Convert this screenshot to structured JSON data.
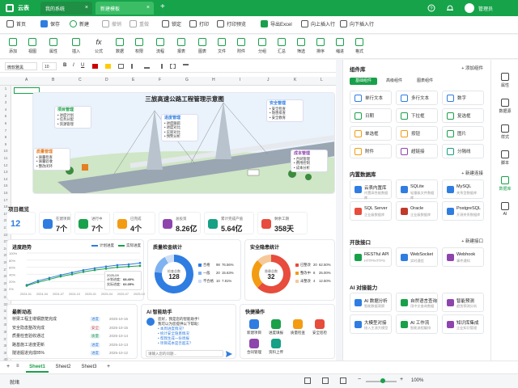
{
  "topbar": {
    "app_name": "云表",
    "tabs": [
      {
        "label": "我的系统"
      },
      {
        "label": "新建模板"
      }
    ],
    "add_tab": "+",
    "user": "管理员"
  },
  "toolbar1": [
    {
      "label": "首页"
    },
    {
      "label": "保存"
    },
    {
      "label": "新建"
    },
    {
      "label": "撤销"
    },
    {
      "label": "重做"
    },
    {
      "label": "锁定"
    },
    {
      "label": "打印"
    },
    {
      "label": "打印预览"
    },
    {
      "label": "导出Excel"
    },
    {
      "label": "向上插入行"
    },
    {
      "label": "向下插入行"
    }
  ],
  "toolbar2": [
    {
      "label": "添加"
    },
    {
      "label": "视图"
    },
    {
      "label": "属性"
    },
    {
      "label": "插入"
    },
    {
      "label": "公式"
    },
    {
      "label": "数据"
    },
    {
      "label": "权限"
    },
    {
      "label": "流程"
    },
    {
      "label": "报表"
    },
    {
      "label": "图表"
    },
    {
      "label": "文件"
    },
    {
      "label": "附件"
    },
    {
      "label": "分组"
    },
    {
      "label": "汇总"
    },
    {
      "label": "筛选"
    },
    {
      "label": "排序"
    },
    {
      "label": "缩进"
    },
    {
      "label": "格式"
    }
  ],
  "format_bar": {
    "font": "微软雅黑",
    "size": "10",
    "bold": "B",
    "italic": "I",
    "underline": "U"
  },
  "columns": [
    "A",
    "B",
    "C",
    "D",
    "E",
    "F",
    "G",
    "H",
    "I",
    "J",
    "K",
    "L"
  ],
  "rows": [
    "1",
    "2",
    "3",
    "4",
    "5",
    "6",
    "7",
    "8",
    "9",
    "10",
    "11",
    "12",
    "13",
    "14",
    "15",
    "16",
    "17",
    "18",
    "19",
    "20",
    "21",
    "22",
    "23",
    "24",
    "25",
    "26",
    "27",
    "28",
    "29",
    "30",
    "31",
    "32",
    "33",
    "34",
    "35",
    "36",
    "37",
    "38",
    "39",
    "40"
  ],
  "illustration": {
    "title": "三旅高速公路工程管理示意图",
    "callouts": [
      {
        "title": "项目管理",
        "items": [
          "• 进度计划",
          "• 任务分配",
          "• 资源管理"
        ]
      },
      {
        "title": "进度管理",
        "items": [
          "• 进度跟踪",
          "• 进度对比",
          "• 实际对比",
          "• 预警分析"
        ]
      },
      {
        "title": "安全管理",
        "items": [
          "• 安全检查",
          "• 隐患排查",
          "• 安全教育"
        ]
      },
      {
        "title": "质量管理",
        "items": [
          "• 质量检查",
          "• 质量验收",
          "• 整改闭环"
        ]
      },
      {
        "title": "成本管理",
        "items": [
          "• 合同管理",
          "• 费用控制",
          "• 成本分析"
        ]
      }
    ]
  },
  "overview": {
    "title": "项目概览",
    "kpis": [
      {
        "label": "",
        "value": "12"
      },
      {
        "label": "在建项目",
        "value": "7个"
      },
      {
        "label": "进行中",
        "value": "7个"
      },
      {
        "label": "已完成",
        "value": "4个"
      },
      {
        "label": "总投资",
        "value": "8.26亿"
      },
      {
        "label": "累计完成产值",
        "value": "5.64亿"
      },
      {
        "label": "剩余工期",
        "value": "358天"
      }
    ]
  },
  "progress_chart": {
    "title": "进度趋势",
    "legend": [
      "计划进度",
      "实际进度"
    ],
    "tooltip": {
      "date": "2025-09",
      "plan_label": "计划进度：",
      "plan_value": "68.40%",
      "actual_label": "实际进度：",
      "actual_value": "62.35%"
    }
  },
  "chart_data": [
    {
      "type": "line",
      "title": "进度趋势",
      "x": [
        "2024-01",
        "2024-04",
        "2024-07",
        "2024-10",
        "2025-01",
        "2025-04",
        "2025-07",
        "2025-10"
      ],
      "series": [
        {
          "name": "计划进度",
          "values": [
            10,
            22,
            30,
            38,
            45,
            52,
            57,
            62,
            66,
            68,
            72
          ]
        },
        {
          "name": "实际进度",
          "values": [
            8,
            18,
            26,
            34,
            40,
            47,
            52,
            56,
            60,
            62,
            64
          ]
        }
      ],
      "ylim": [
        0,
        100
      ],
      "yticks": [
        "100%",
        "80%",
        "60%",
        "40%",
        "20%",
        "0%"
      ]
    },
    {
      "type": "pie",
      "title": "质量检查统计",
      "center_label": "检查总数",
      "center_value": "128",
      "slices": [
        {
          "label": "合格",
          "value": 98,
          "pct": "76.56%"
        },
        {
          "label": "一般",
          "value": 20,
          "pct": "15.63%"
        },
        {
          "label": "不合格",
          "value": 10,
          "pct": "7.81%"
        }
      ]
    },
    {
      "type": "pie",
      "title": "安全隐患统计",
      "center_label": "隐患总数",
      "center_value": "32",
      "slices": [
        {
          "label": "已整改",
          "value": 20,
          "pct": "62.50%"
        },
        {
          "label": "整改中",
          "value": 8,
          "pct": "25.00%"
        },
        {
          "label": "未整改",
          "value": 4,
          "pct": "12.50%"
        }
      ]
    }
  ],
  "news": {
    "title": "最新动态",
    "items": [
      {
        "text": "桥梁工程主墩钢筋笼完成",
        "tag": "进度",
        "date": "2025-10-16"
      },
      {
        "text": "安全隐患整改完成",
        "tag": "安全",
        "date": "2025-10-15"
      },
      {
        "text": "质量检查验收通过",
        "tag": "质量",
        "date": "2025-10-14"
      },
      {
        "text": "路基施工进度更新",
        "tag": "进度",
        "date": "2025-10-13"
      },
      {
        "text": "隧道掘进完成85%",
        "tag": "进度",
        "date": "2025-10-12"
      }
    ]
  },
  "ai_assistant": {
    "title": "AI 智能助手",
    "greeting": "您好，我是您的智能助手！",
    "intro": "我可以为您提供以下帮助：",
    "items": [
      "• 本周进度情况？",
      "• 统计安全隐患情况",
      "• 帮我生成一份周报",
      "• 项目成本是否超支？"
    ],
    "placeholder": "请输入您的问题..."
  },
  "quick_actions": {
    "title": "快捷操作",
    "items": [
      {
        "label": "新建项目",
        "color": "#2f7de1"
      },
      {
        "label": "进度填报",
        "color": "#19a04a"
      },
      {
        "label": "质量检查",
        "color": "#f39c12"
      },
      {
        "label": "安全巡检",
        "color": "#e74c3c"
      },
      {
        "label": "合同管理",
        "color": "#8e44ad"
      },
      {
        "label": "资料上传",
        "color": "#16a085"
      }
    ]
  },
  "sheet_tabs": [
    "Sheet1",
    "Sheet2",
    "Sheet3"
  ],
  "status": {
    "text": "就绪",
    "zoom": "100%"
  },
  "right_panel": {
    "components": {
      "title": "组件库",
      "add": "+ 添加组件",
      "tabs": [
        "基础组件",
        "高级组件",
        "图表组件"
      ],
      "items": [
        {
          "label": "单行文本"
        },
        {
          "label": "多行文本"
        },
        {
          "label": "数字"
        },
        {
          "label": "日期"
        },
        {
          "label": "下拉框"
        },
        {
          "label": "复选框"
        },
        {
          "label": "单选框"
        },
        {
          "label": "按钮"
        },
        {
          "label": "图片"
        },
        {
          "label": "附件"
        },
        {
          "label": "超链接"
        },
        {
          "label": "分隔线"
        }
      ]
    },
    "databases": {
      "title": "内置数据库",
      "add": "+ 新建连接",
      "items": [
        {
          "name": "云表内置库",
          "desc": "内置高性能数据库"
        },
        {
          "name": "SQLite",
          "desc": "轻量级文件数据库"
        },
        {
          "name": "MySQL",
          "desc": "关系型数据库"
        },
        {
          "name": "SQL Server",
          "desc": "企业级数据库"
        },
        {
          "name": "Oracle",
          "desc": "企业级数据库"
        },
        {
          "name": "PostgreSQL",
          "desc": "开源关系数据库"
        }
      ]
    },
    "apis": {
      "title": "开放接口",
      "add": "+ 新建接口",
      "items": [
        {
          "name": "RESTful API",
          "desc": "HTTP/HTTPS"
        },
        {
          "name": "WebSocket",
          "desc": "实时通信"
        },
        {
          "name": "Webhook",
          "desc": "事件通知"
        }
      ]
    },
    "ai": {
      "title": "AI 对接能力",
      "items": [
        {
          "name": "AI 数据分析",
          "desc": "智能数据洞察"
        },
        {
          "name": "自然语言查询",
          "desc": "用中文查询数据"
        },
        {
          "name": "智能预测",
          "desc": "趋势预测分析"
        },
        {
          "name": "大模型对接",
          "desc": "接入主流大模型"
        },
        {
          "name": "AI 工作流",
          "desc": "智能流程编排"
        },
        {
          "name": "知识库集成",
          "desc": "企业知识管理"
        }
      ]
    }
  },
  "rail": [
    {
      "label": "属性"
    },
    {
      "label": "数据源"
    },
    {
      "label": "样式"
    },
    {
      "label": "脚本"
    },
    {
      "label": "数据库"
    },
    {
      "label": "AI"
    }
  ],
  "colors": {
    "brand": "#17a34a",
    "accent": "#2f7de1",
    "red": "#e74c3c",
    "orange": "#f39c12"
  }
}
